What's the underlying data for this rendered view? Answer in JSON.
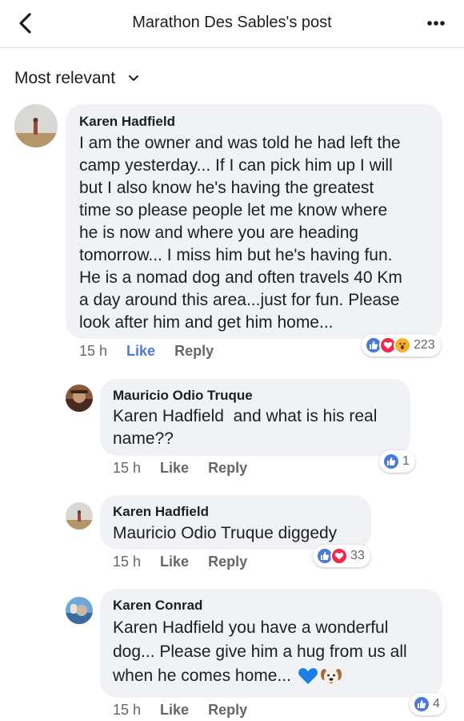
{
  "header": {
    "title": "Marathon Des Sables's post"
  },
  "sort": {
    "label": "Most relevant"
  },
  "comments": [
    {
      "author": "Karen Hadfield",
      "lines": [
        "I am the owner and was told he had left the",
        "camp yesterday... If I can pick him up I will",
        "but I also know he's having the greatest",
        "time so please people let me know where",
        "he is now and where you are heading",
        "tomorrow... I miss him but he's having fun.",
        "He is a nomad dog and often travels 40 Km",
        "a day around this area...just for fun. Please",
        "look after him and get him home..."
      ],
      "time": "15 h",
      "like": "Like",
      "reply": "Reply",
      "reactions": {
        "icons": [
          "like-icon",
          "love-icon",
          "wow-icon"
        ],
        "count": "223"
      }
    },
    {
      "author": "Mauricio Odio Truque",
      "mention": "Karen Hadfield",
      "lines": [
        "and what is his real",
        "name??"
      ],
      "time": "15 h",
      "like": "Like",
      "reply": "Reply",
      "reactions": {
        "icons": [
          "like-icon"
        ],
        "count": "1"
      }
    },
    {
      "author": "Karen Hadfield",
      "mention": "Mauricio Odio Truque",
      "lines": [
        "diggedy"
      ],
      "time": "15 h",
      "like": "Like",
      "reply": "Reply",
      "reactions": {
        "icons": [
          "like-icon",
          "love-icon"
        ],
        "count": "33"
      }
    },
    {
      "author": "Karen Conrad",
      "mention": "Karen Hadfield",
      "lines": [
        "you have a wonderful",
        "dog... Please give him a hug from us all",
        "when he comes home..."
      ],
      "emoji": [
        "blue-heart-icon",
        "dog-face-icon"
      ],
      "time": "15 h",
      "like": "Like",
      "reply": "Reply",
      "reactions": {
        "icons": [
          "like-icon"
        ],
        "count": "4"
      }
    }
  ],
  "colors": {
    "accent": "#4a7bdb",
    "bubble": "#f0f2f5",
    "meta": "#65676b",
    "like_reaction": "#4a7bdb",
    "love_reaction": "#f0284a",
    "wow_reaction": "#f7b125"
  }
}
